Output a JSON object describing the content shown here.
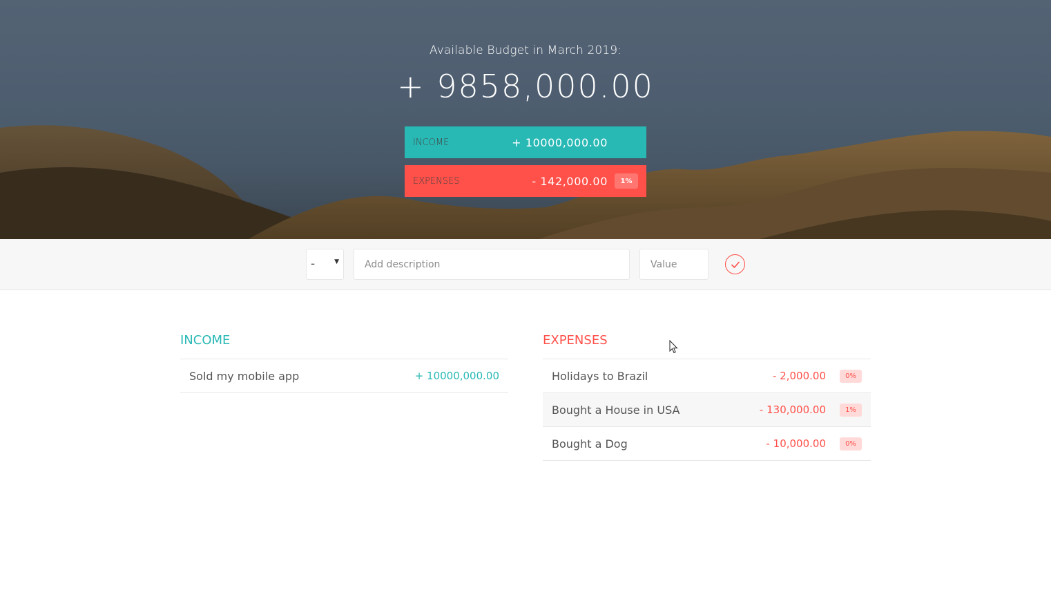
{
  "header": {
    "title": "Available Budget in March 2019:",
    "budget": "+ 9858,000.00",
    "income_label": "Income",
    "income_value": "+ 10000,000.00",
    "expenses_label": "Expenses",
    "expenses_value": "- 142,000.00",
    "expenses_percentage": "1%"
  },
  "add_form": {
    "type_selected": "-",
    "description_placeholder": "Add description",
    "value_placeholder": "Value"
  },
  "income": {
    "heading": "Income",
    "items": [
      {
        "description": "Sold my mobile app",
        "value": "+ 10000,000.00"
      }
    ]
  },
  "expenses": {
    "heading": "Expenses",
    "items": [
      {
        "description": "Holidays to Brazil",
        "value": "- 2,000.00",
        "percentage": "0%"
      },
      {
        "description": "Bought a House in USA",
        "value": "- 130,000.00",
        "percentage": "1%"
      },
      {
        "description": "Bought a Dog",
        "value": "- 10,000.00",
        "percentage": "0%"
      }
    ]
  },
  "colors": {
    "income_accent": "#28b9b5",
    "expense_accent": "#ff5049"
  }
}
